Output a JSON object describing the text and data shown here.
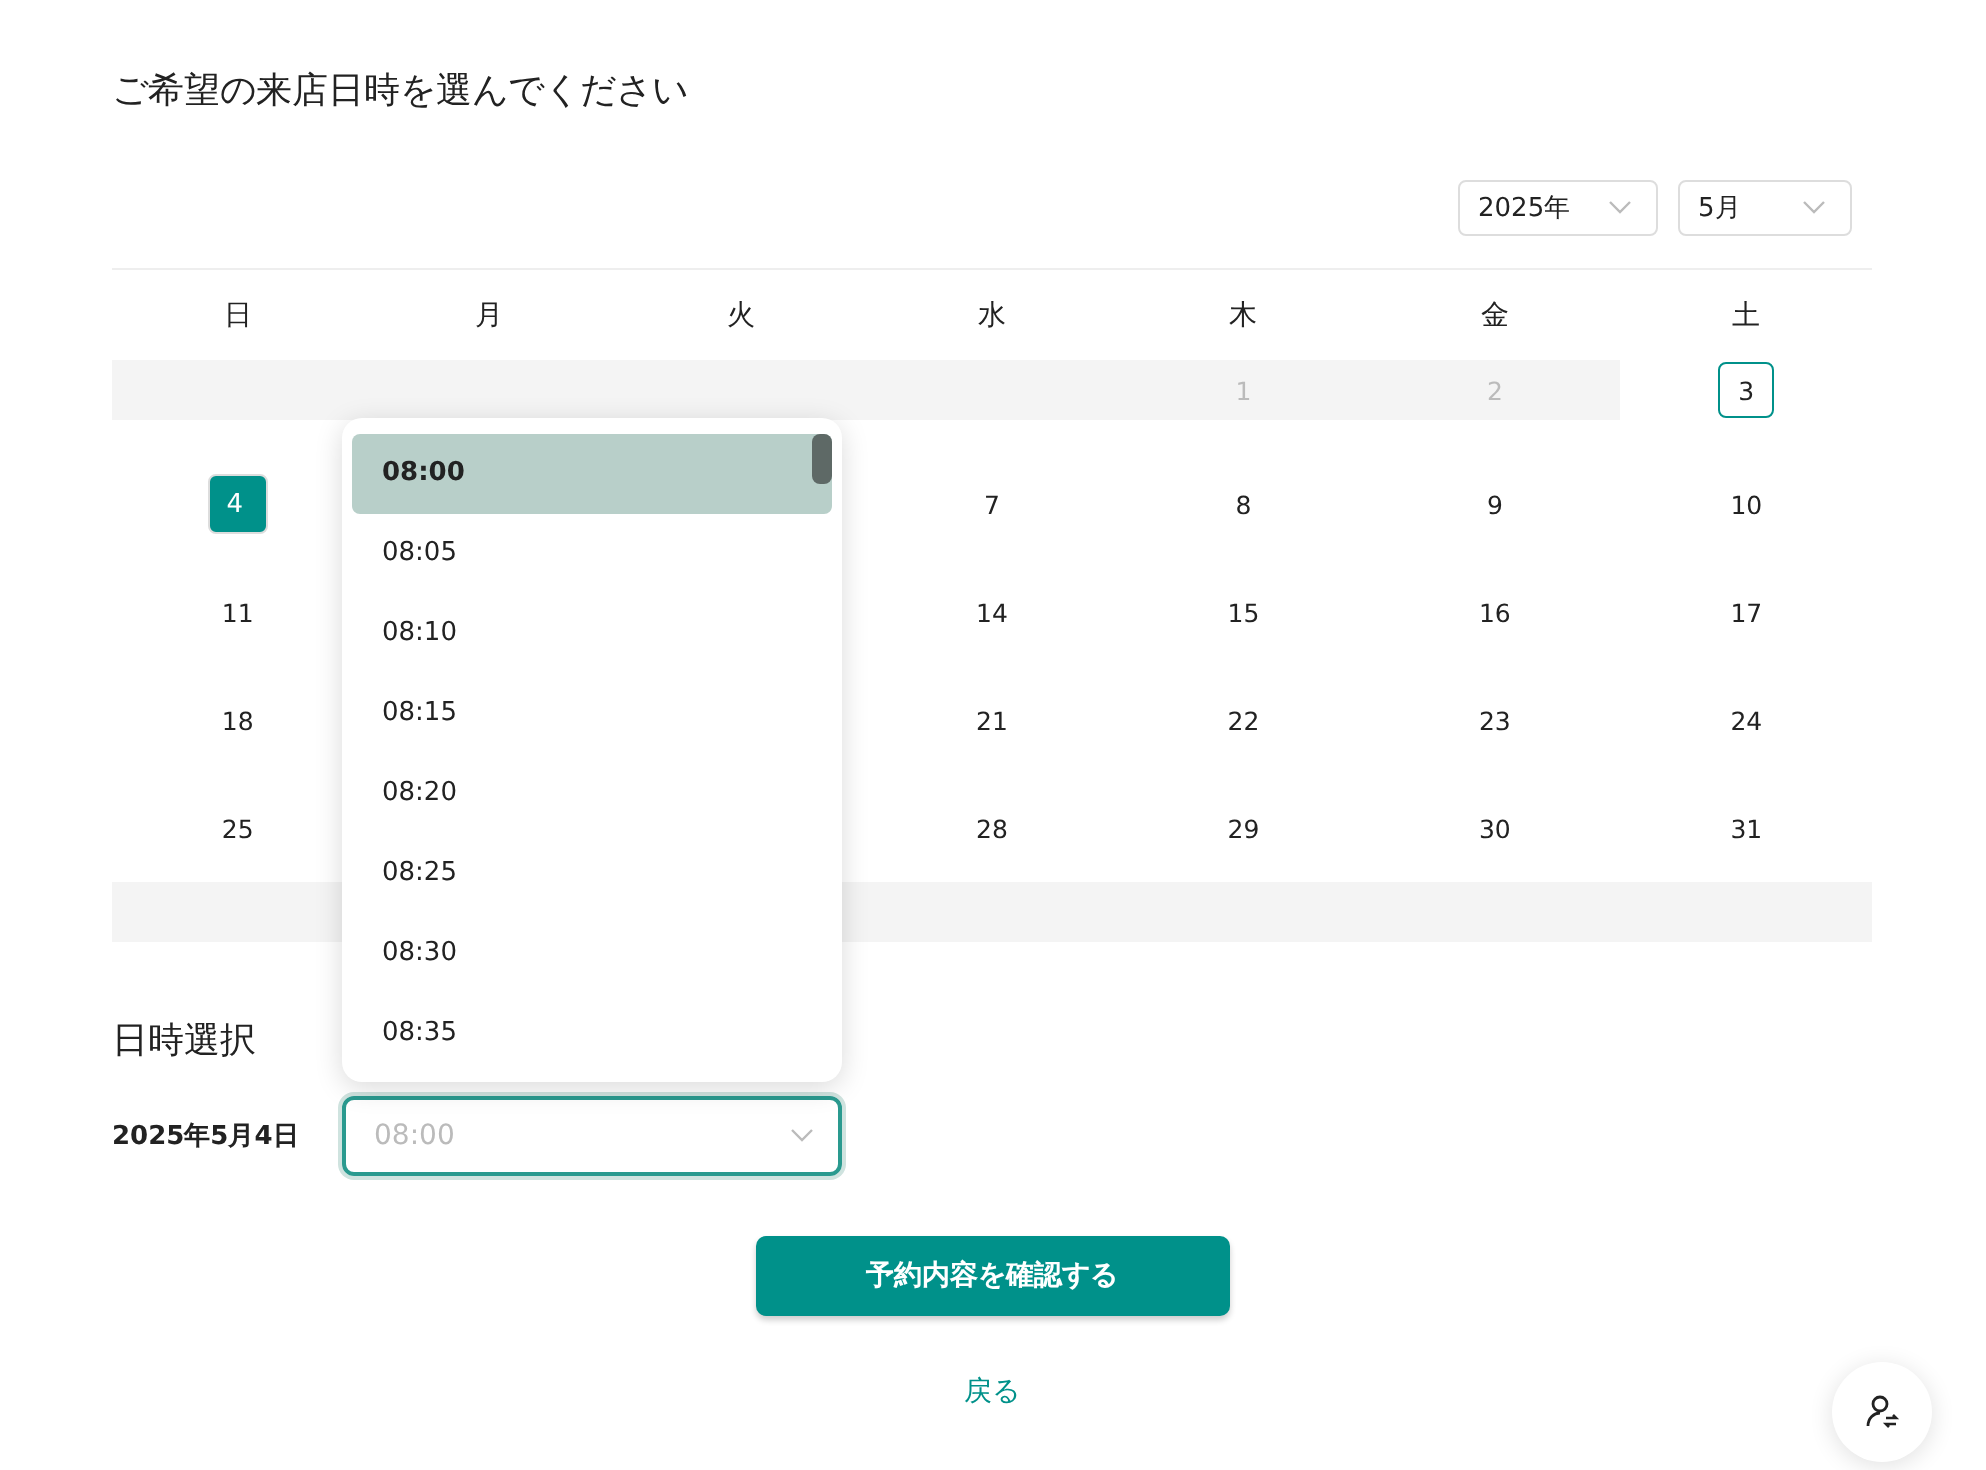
{
  "title": "ご希望の来店日時を選んでください",
  "year_select": {
    "value": "2025年"
  },
  "month_select": {
    "value": "5月"
  },
  "weekdays": [
    "日",
    "月",
    "火",
    "水",
    "木",
    "金",
    "土"
  ],
  "weeks": [
    [
      {
        "kind": "empty"
      },
      {
        "kind": "empty"
      },
      {
        "kind": "empty"
      },
      {
        "kind": "empty"
      },
      {
        "kind": "disabled",
        "day": "1"
      },
      {
        "kind": "disabled",
        "day": "2"
      },
      {
        "kind": "day",
        "day": "3",
        "today": true,
        "selected": false
      }
    ],
    [
      {
        "kind": "day",
        "day": "4",
        "selected": true
      },
      {
        "kind": "hidden"
      },
      {
        "kind": "hidden"
      },
      {
        "kind": "day",
        "day": "7",
        "selected": false
      },
      {
        "kind": "day",
        "day": "8",
        "selected": false
      },
      {
        "kind": "day",
        "day": "9",
        "selected": false
      },
      {
        "kind": "day",
        "day": "10",
        "selected": false
      }
    ],
    [
      {
        "kind": "day",
        "day": "11",
        "selected": false
      },
      {
        "kind": "hidden"
      },
      {
        "kind": "hidden"
      },
      {
        "kind": "day",
        "day": "14",
        "selected": false
      },
      {
        "kind": "day",
        "day": "15",
        "selected": false
      },
      {
        "kind": "day",
        "day": "16",
        "selected": false
      },
      {
        "kind": "day",
        "day": "17",
        "selected": false
      }
    ],
    [
      {
        "kind": "day",
        "day": "18",
        "selected": false
      },
      {
        "kind": "hidden"
      },
      {
        "kind": "hidden"
      },
      {
        "kind": "day",
        "day": "21",
        "selected": false
      },
      {
        "kind": "day",
        "day": "22",
        "selected": false
      },
      {
        "kind": "day",
        "day": "23",
        "selected": false
      },
      {
        "kind": "day",
        "day": "24",
        "selected": false
      }
    ],
    [
      {
        "kind": "day",
        "day": "25",
        "selected": false
      },
      {
        "kind": "hidden"
      },
      {
        "kind": "hidden"
      },
      {
        "kind": "day",
        "day": "28",
        "selected": false
      },
      {
        "kind": "day",
        "day": "29",
        "selected": false
      },
      {
        "kind": "day",
        "day": "30",
        "selected": false
      },
      {
        "kind": "day",
        "day": "31",
        "selected": false
      }
    ],
    [
      {
        "kind": "empty"
      },
      {
        "kind": "covered"
      },
      {
        "kind": "empty"
      },
      {
        "kind": "empty"
      },
      {
        "kind": "empty"
      },
      {
        "kind": "empty"
      },
      {
        "kind": "empty"
      }
    ]
  ],
  "section_title": "日時選択",
  "date_label": "2025年5月4日",
  "time_select": {
    "placeholder": "08:00"
  },
  "time_dropdown": {
    "options": [
      {
        "label": "08:00",
        "selected": true
      },
      {
        "label": "08:05",
        "selected": false
      },
      {
        "label": "08:10",
        "selected": false
      },
      {
        "label": "08:15",
        "selected": false
      },
      {
        "label": "08:20",
        "selected": false
      },
      {
        "label": "08:25",
        "selected": false
      },
      {
        "label": "08:30",
        "selected": false
      },
      {
        "label": "08:35",
        "selected": false
      }
    ]
  },
  "confirm_button": "予約内容を確認する",
  "back_link": "戻る"
}
